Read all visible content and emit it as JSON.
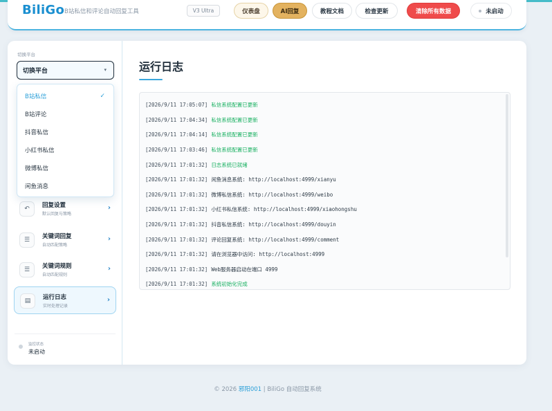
{
  "header": {
    "logo": "BiliGo",
    "subtitle": "B站私信和评论自动回复工具",
    "version_badge": "V3 Ultra",
    "dashboard_label": "仪表盘",
    "ai_reply_label": "AI回复",
    "docs_label": "教程文档",
    "update_label": "检查更新",
    "clear_label": "清除所有数据",
    "status_label": "未启动"
  },
  "sidebar": {
    "switch_label": "切换平台",
    "select_value": "切换平台",
    "dropdown": [
      {
        "label": "B站私信",
        "selected": true
      },
      {
        "label": "B站评论",
        "selected": false
      },
      {
        "label": "抖音私信",
        "selected": false
      },
      {
        "label": "小红书私信",
        "selected": false
      },
      {
        "label": "微博私信",
        "selected": false
      },
      {
        "label": "闲鱼消息",
        "selected": false
      }
    ],
    "check_mark": "✓",
    "nav": [
      {
        "title": "回复设置",
        "desc": "默认回复与策略",
        "icon": "reply-icon",
        "active": false
      },
      {
        "title": "关键词回复",
        "desc": "自动匹配策略",
        "icon": "sliders-icon",
        "active": false
      },
      {
        "title": "关键词规则",
        "desc": "自动匹配规则",
        "icon": "sliders-icon",
        "active": false
      },
      {
        "title": "运行日志",
        "desc": "实时处理记录",
        "icon": "log-icon",
        "active": true
      }
    ],
    "monitor_label": "监控状态",
    "monitor_value": "未启动"
  },
  "main": {
    "title": "运行日志",
    "logs": [
      {
        "time": "[2026/9/11 17:05:07]",
        "message": "私信系统配置已更新",
        "type": "success"
      },
      {
        "time": "[2026/9/11 17:04:34]",
        "message": "私信系统配置已更新",
        "type": "success"
      },
      {
        "time": "[2026/9/11 17:04:14]",
        "message": "私信系统配置已更新",
        "type": "success"
      },
      {
        "time": "[2026/9/11 17:03:46]",
        "message": "私信系统配置已更新",
        "type": "success"
      },
      {
        "time": "[2026/9/11 17:01:32]",
        "message": "日志系统已就绪",
        "type": "success"
      },
      {
        "time": "[2026/9/11 17:01:32]",
        "message": "闲鱼消息系统: http://localhost:4999/xianyu",
        "type": "info"
      },
      {
        "time": "[2026/9/11 17:01:32]",
        "message": "微博私信系统: http://localhost:4999/weibo",
        "type": "info"
      },
      {
        "time": "[2026/9/11 17:01:32]",
        "message": "小红书私信系统: http://localhost:4999/xiaohongshu",
        "type": "info"
      },
      {
        "time": "[2026/9/11 17:01:32]",
        "message": "抖音私信系统: http://localhost:4999/douyin",
        "type": "info"
      },
      {
        "time": "[2026/9/11 17:01:32]",
        "message": "评论回复系统: http://localhost:4999/comment",
        "type": "info"
      },
      {
        "time": "[2026/9/11 17:01:32]",
        "message": "请在浏览器中访问: http://localhost:4999",
        "type": "info"
      },
      {
        "time": "[2026/9/11 17:01:32]",
        "message": "Web服务器启动在端口 4999",
        "type": "info"
      },
      {
        "time": "[2026/9/11 17:01:32]",
        "message": "系统初始化完成",
        "type": "success"
      }
    ]
  },
  "footer": {
    "prefix": "© 2026 ",
    "author": "邪阳001",
    "suffix": " | BiliGo 自动回复系统"
  },
  "colors": {
    "accent": "#2a9fd8",
    "success": "#19b061",
    "danger": "#ef4b4b",
    "gold": "#e3b25f"
  }
}
